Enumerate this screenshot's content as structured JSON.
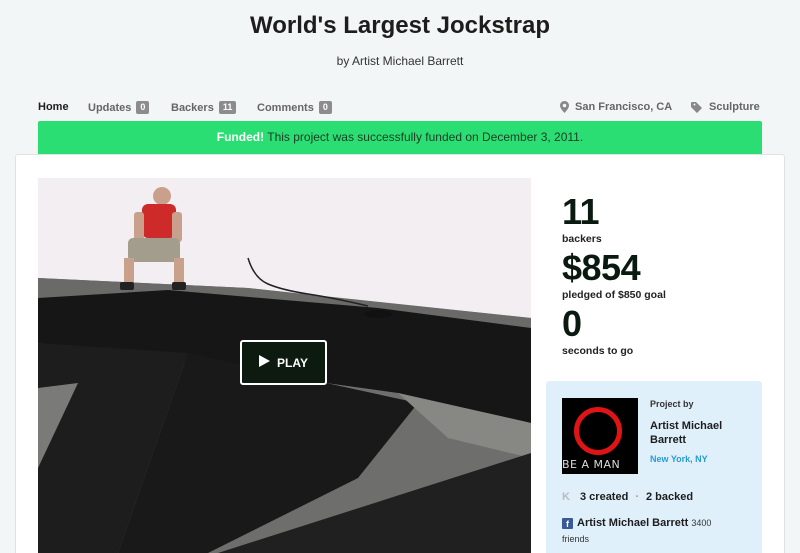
{
  "project": {
    "title": "World's Largest Jockstrap",
    "byline": "by Artist Michael Barrett"
  },
  "subnav": {
    "home": "Home",
    "updates_label": "Updates",
    "updates_count": "0",
    "backers_label": "Backers",
    "backers_count": "11",
    "comments_label": "Comments",
    "comments_count": "0",
    "location": "San Francisco, CA",
    "category": "Sculpture"
  },
  "banner": {
    "strong": "Funded!",
    "text": " This project was successfully funded on December 3, 2011."
  },
  "video": {
    "play_label": "PLAY"
  },
  "stats": {
    "backers_value": "11",
    "backers_label": "backers",
    "pledged_value": "$854",
    "pledged_label": "pledged of $850 goal",
    "time_value": "0",
    "time_label": "seconds to go"
  },
  "creator": {
    "avatar_text": "BE A MAN",
    "project_by": "Project by",
    "name": "Artist Michael Barrett",
    "location": "New York, NY",
    "created": "3 created",
    "backed": "2 backed",
    "fb_name": "Artist Michael Barrett",
    "fb_friends": "3400",
    "fb_friends_suffix": "friends"
  },
  "colors": {
    "funded_green": "#2bde73",
    "creator_bg": "#e0f0fb",
    "link_blue": "#2a9bd1"
  }
}
